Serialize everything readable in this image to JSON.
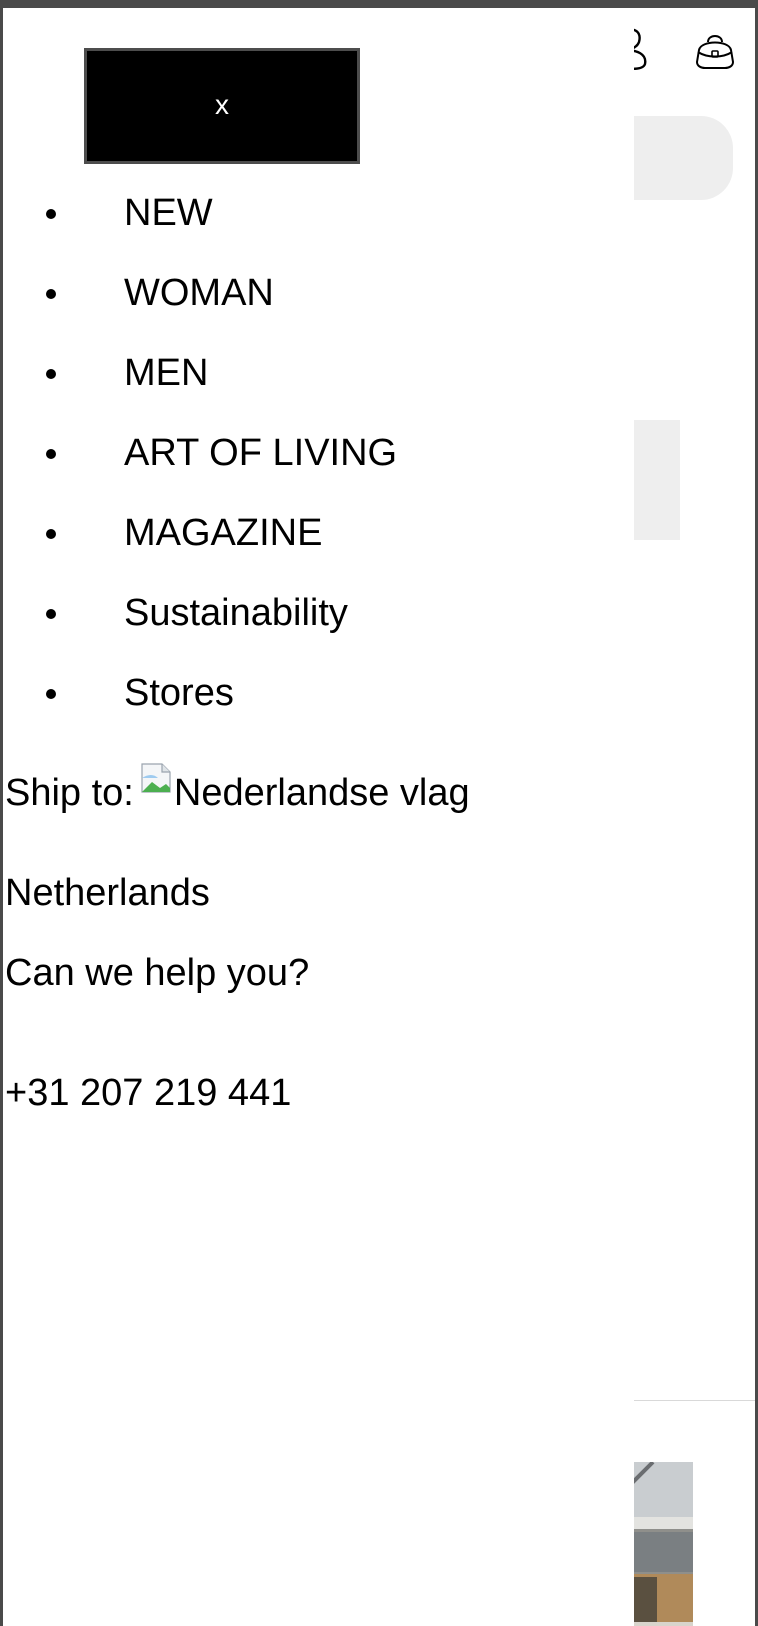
{
  "menu": {
    "close_label": "x",
    "items": [
      {
        "label": "NEW"
      },
      {
        "label": "WOMAN"
      },
      {
        "label": "MEN"
      },
      {
        "label": "ART OF LIVING"
      },
      {
        "label": "MAGAZINE"
      },
      {
        "label": "Sustainability"
      },
      {
        "label": "Stores"
      }
    ]
  },
  "shipping": {
    "prefix": "Ship to:",
    "flag_alt": "Nederlandse vlag",
    "country": "Netherlands"
  },
  "help": {
    "question": "Can we help you?",
    "phone": "+31 207 219 441"
  },
  "header": {
    "account_icon": "account-icon",
    "bag_icon": "shopping-bag-icon"
  }
}
